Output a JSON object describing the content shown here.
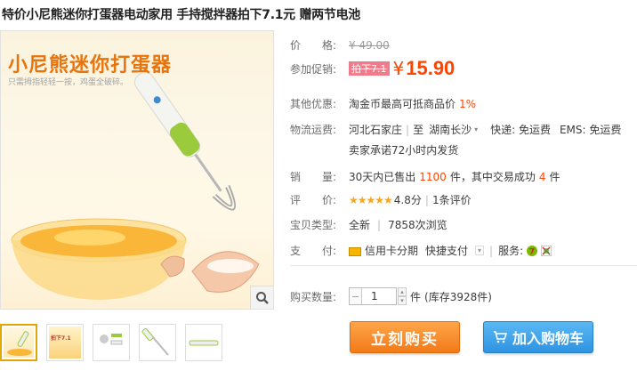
{
  "product": {
    "title": "特价小尼熊迷你打蛋器电动家用 手持搅拌器拍下7.1元 赠两节电池"
  },
  "image": {
    "brand_text": "小尼熊迷你打蛋器",
    "brand_sub": "只需拇指轻轻一按，鸡蛋全破碎。",
    "zoom_icon": "magnifier-icon",
    "thumbs": [
      {
        "label": "thumb-1",
        "active": true
      },
      {
        "label": "thumb-2",
        "badge": "拍下7.1"
      },
      {
        "label": "thumb-3"
      },
      {
        "label": "thumb-4"
      },
      {
        "label": "thumb-5"
      }
    ]
  },
  "price": {
    "label": "价　　格:",
    "original": "¥ 49.00"
  },
  "promo": {
    "label": "参加促销:",
    "tag": "拍下7.1",
    "yen": "¥",
    "price": "15.90"
  },
  "other_offer": {
    "label": "其他优惠:",
    "text": "淘金币最高可抵商品价",
    "percent": "1%"
  },
  "shipping": {
    "label": "物流运费:",
    "from": "河北石家庄",
    "sep": "|",
    "to_prefix": "至",
    "to": "湖南长沙",
    "express": "快递: 免运费",
    "ems": "EMS: 免运费",
    "promise": "卖家承诺72小时内发货"
  },
  "sales": {
    "label": "销　　量:",
    "prefix": "30天内已售出",
    "count": "1100",
    "middle": "件，其中交易成功",
    "success": "4",
    "suffix": "件"
  },
  "rating": {
    "label": "评　　价:",
    "stars": "★★★★★",
    "score": "4.8分",
    "sep": "|",
    "reviews": "1条评价"
  },
  "item_type": {
    "label": "宝贝类型:",
    "condition": "全新",
    "sep": "|",
    "views": "7858次浏览"
  },
  "payment": {
    "label": "支　　付:",
    "credit": "信用卡分期",
    "quick": "快捷支付",
    "service_label": "服务:"
  },
  "quantity": {
    "label": "购买数量:",
    "value": "1",
    "unit": "件",
    "stock": "(库存3928件)"
  },
  "buttons": {
    "buy": "立刻购买",
    "cart": "加入购物车"
  },
  "colors": {
    "accent_orange": "#ff4400",
    "buy_button": "#f27a18",
    "cart_button": "#2f93e2"
  }
}
